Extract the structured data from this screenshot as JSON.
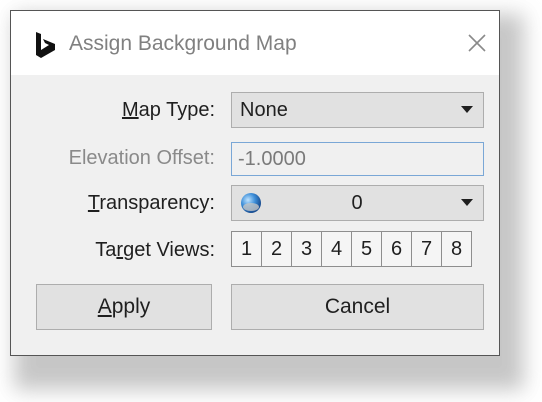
{
  "dialog": {
    "title": "Assign Background Map",
    "app_icon": "bing-logo-icon",
    "close_icon": "close-icon"
  },
  "map_type": {
    "label_mnemonic": "M",
    "label_rest": "ap Type:",
    "value": "None"
  },
  "elevation_offset": {
    "label": "Elevation Offset:",
    "value": "-1.0000"
  },
  "transparency": {
    "label_mnemonic": "T",
    "label_rest": "ransparency:",
    "value": "0",
    "icon": "globe-icon"
  },
  "target_views": {
    "label_pre": "Ta",
    "label_mnemonic": "r",
    "label_rest": "get Views:",
    "views": [
      "1",
      "2",
      "3",
      "4",
      "5",
      "6",
      "7",
      "8"
    ]
  },
  "buttons": {
    "apply_mnemonic": "A",
    "apply_rest": "pply",
    "cancel": "Cancel"
  },
  "colors": {
    "dialog_bg": "#f0f0f0",
    "button_bg": "#e1e1e1",
    "focus_border": "#7aa7d6",
    "disabled_text": "#8a8a8a"
  }
}
